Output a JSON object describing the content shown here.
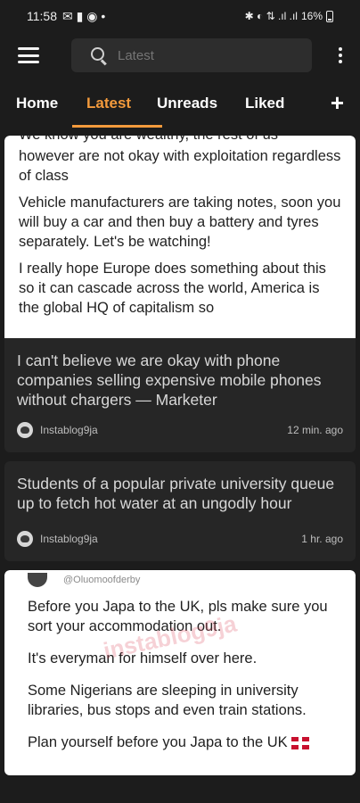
{
  "status": {
    "time": "11:58",
    "battery": "16%"
  },
  "search": {
    "placeholder": "Latest",
    "value": ""
  },
  "tabs": [
    {
      "label": "Home"
    },
    {
      "label": "Latest"
    },
    {
      "label": "Unreads"
    },
    {
      "label": "Liked"
    }
  ],
  "add_tab_label": "+",
  "colors": {
    "accent": "#f39a3c",
    "background": "#1c1c1c",
    "card": "#262626"
  },
  "posts": [
    {
      "image_lines": [
        "We know you are wealthy, the rest of us",
        "however are not okay with exploitation regardless of class",
        "Vehicle manufacturers are taking notes, soon you will buy a car and then buy a battery and tyres separately. Let's be watching!",
        "I really hope Europe does something about this so it can cascade across the world, America is the global HQ of capitalism so"
      ],
      "title": "I can't believe we are okay with phone companies selling expensive mobile phones without chargers — Marketer",
      "author": "Instablog9ja",
      "time": "12 min. ago"
    },
    {
      "title": "Students of a popular private university queue up to fetch hot water at an ungodly hour",
      "author": "Instablog9ja",
      "time": "1 hr. ago"
    },
    {
      "handle": "@Oluomoofderby",
      "watermark": "instablog9ja",
      "image_lines": [
        "Before you Japa to the UK, pls make sure you sort your accommodation out.",
        "It's everyman for himself over here.",
        "Some Nigerians are sleeping in university libraries, bus stops and even train stations.",
        "Plan yourself before you Japa to the UK"
      ]
    }
  ]
}
